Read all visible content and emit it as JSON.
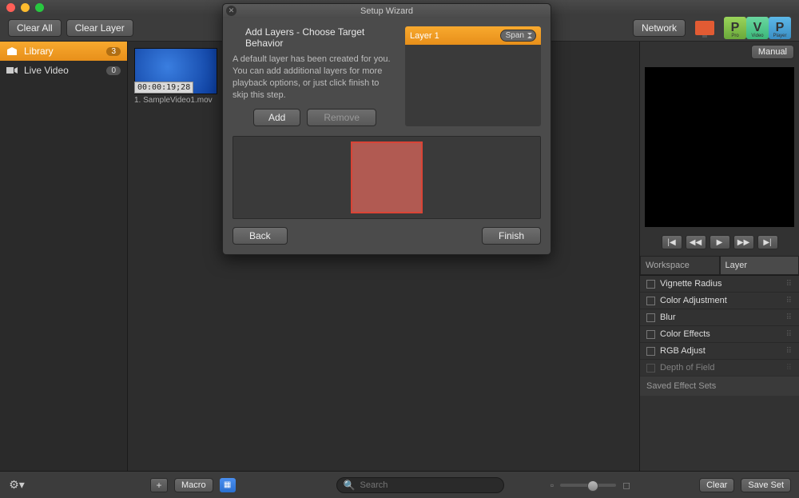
{
  "toolbar": {
    "clear_all": "Clear All",
    "clear_layer": "Clear Layer",
    "network": "Network",
    "manual": "Manual",
    "logos": [
      {
        "letter": "P",
        "sub": "Pro"
      },
      {
        "letter": "V",
        "sub": "Video"
      },
      {
        "letter": "P",
        "sub": "Player"
      }
    ]
  },
  "sidebar": {
    "items": [
      {
        "label": "Library",
        "count": "3",
        "active": true,
        "icon": "library"
      },
      {
        "label": "Live Video",
        "count": "0",
        "active": false,
        "icon": "camera"
      }
    ]
  },
  "thumb": {
    "timecode": "00:00:19;28",
    "name": "1. SampleVideo1.mov"
  },
  "right": {
    "tabs": [
      {
        "label": "Workspace",
        "active": false
      },
      {
        "label": "Layer",
        "active": true
      }
    ],
    "effects": [
      "Vignette Radius",
      "Color Adjustment",
      "Blur",
      "Color Effects",
      "RGB Adjust",
      "Depth of Field"
    ],
    "saved_header": "Saved Effect Sets"
  },
  "footer": {
    "macro": "Macro",
    "search_placeholder": "Search",
    "clear": "Clear",
    "save_set": "Save Set"
  },
  "modal": {
    "title": "Setup Wizard",
    "subtitle": "Add Layers - Choose Target Behavior",
    "desc": "A default layer has been created for you. You can add additional layers for more playback options, or just click finish to skip this step.",
    "add": "Add",
    "remove": "Remove",
    "layer_name": "Layer 1",
    "layer_mode": "Span",
    "back": "Back",
    "finish": "Finish"
  }
}
